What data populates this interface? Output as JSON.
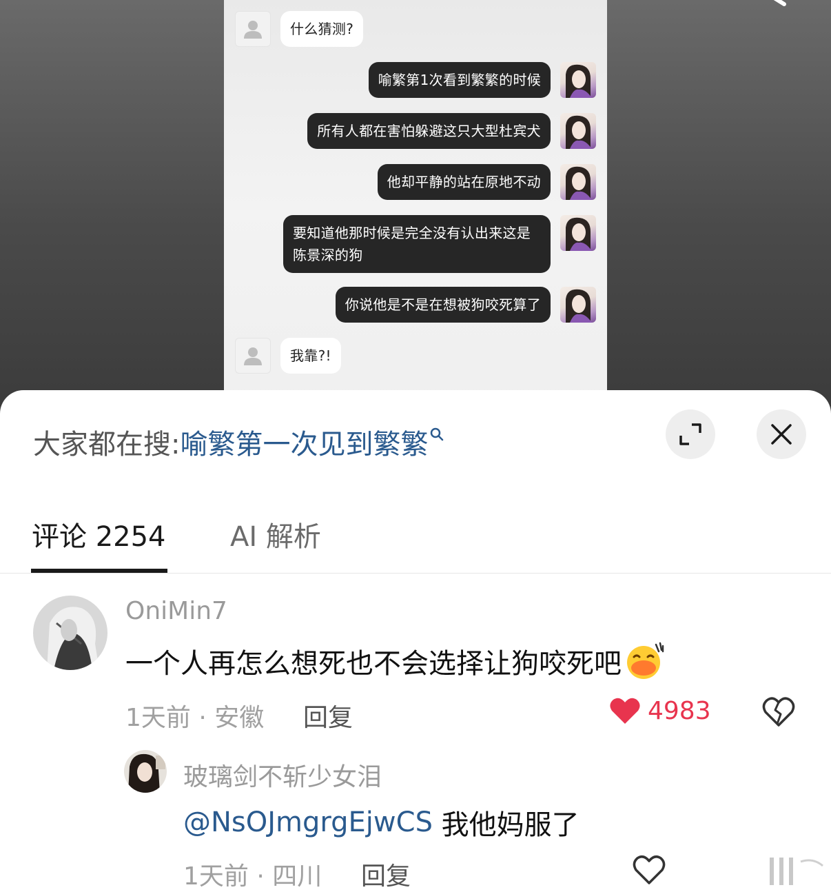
{
  "chat": {
    "messages": [
      {
        "side": "left",
        "text": "什么猜测?"
      },
      {
        "side": "right",
        "text": "喻繁第1次看到繁繁的时候"
      },
      {
        "side": "right",
        "text": "所有人都在害怕躲避这只大型杜宾犬"
      },
      {
        "side": "right",
        "text": "他却平静的站在原地不动"
      },
      {
        "side": "right",
        "text": "要知道他那时候是完全没有认出来这是陈景深的狗"
      },
      {
        "side": "right",
        "text": "你说他是不是在想被狗咬死算了"
      },
      {
        "side": "left",
        "text": "我靠?!"
      }
    ]
  },
  "search": {
    "prefix": "大家都在搜:",
    "term": "喻繁第一次见到繁繁"
  },
  "tabs": {
    "comments_label": "评论 2254",
    "ai_label": "AI 解析"
  },
  "comments": [
    {
      "user": "OniMin7",
      "text": "一个人再怎么想死也不会选择让狗咬死吧",
      "time_location": "1天前 · 安徽",
      "reply_label": "回复",
      "likes": "4983",
      "liked": true
    },
    {
      "user": "玻璃剑不斩少女泪",
      "mention": "@NsOJmgrgEjwCS",
      "text": " 我他妈服了",
      "time_location": "1天前 · 四川",
      "reply_label": "回复",
      "liked": false
    }
  ],
  "icons": {
    "expand": "expand-icon",
    "close": "close-icon",
    "like": "heart-icon",
    "dislike": "broken-heart-icon",
    "emoji": "laughing-emoji-icon",
    "search": "search-icon"
  },
  "colors": {
    "accent_blue": "#2a5a8e",
    "like_red": "#e8344e",
    "bubble_dark": "#262626"
  }
}
